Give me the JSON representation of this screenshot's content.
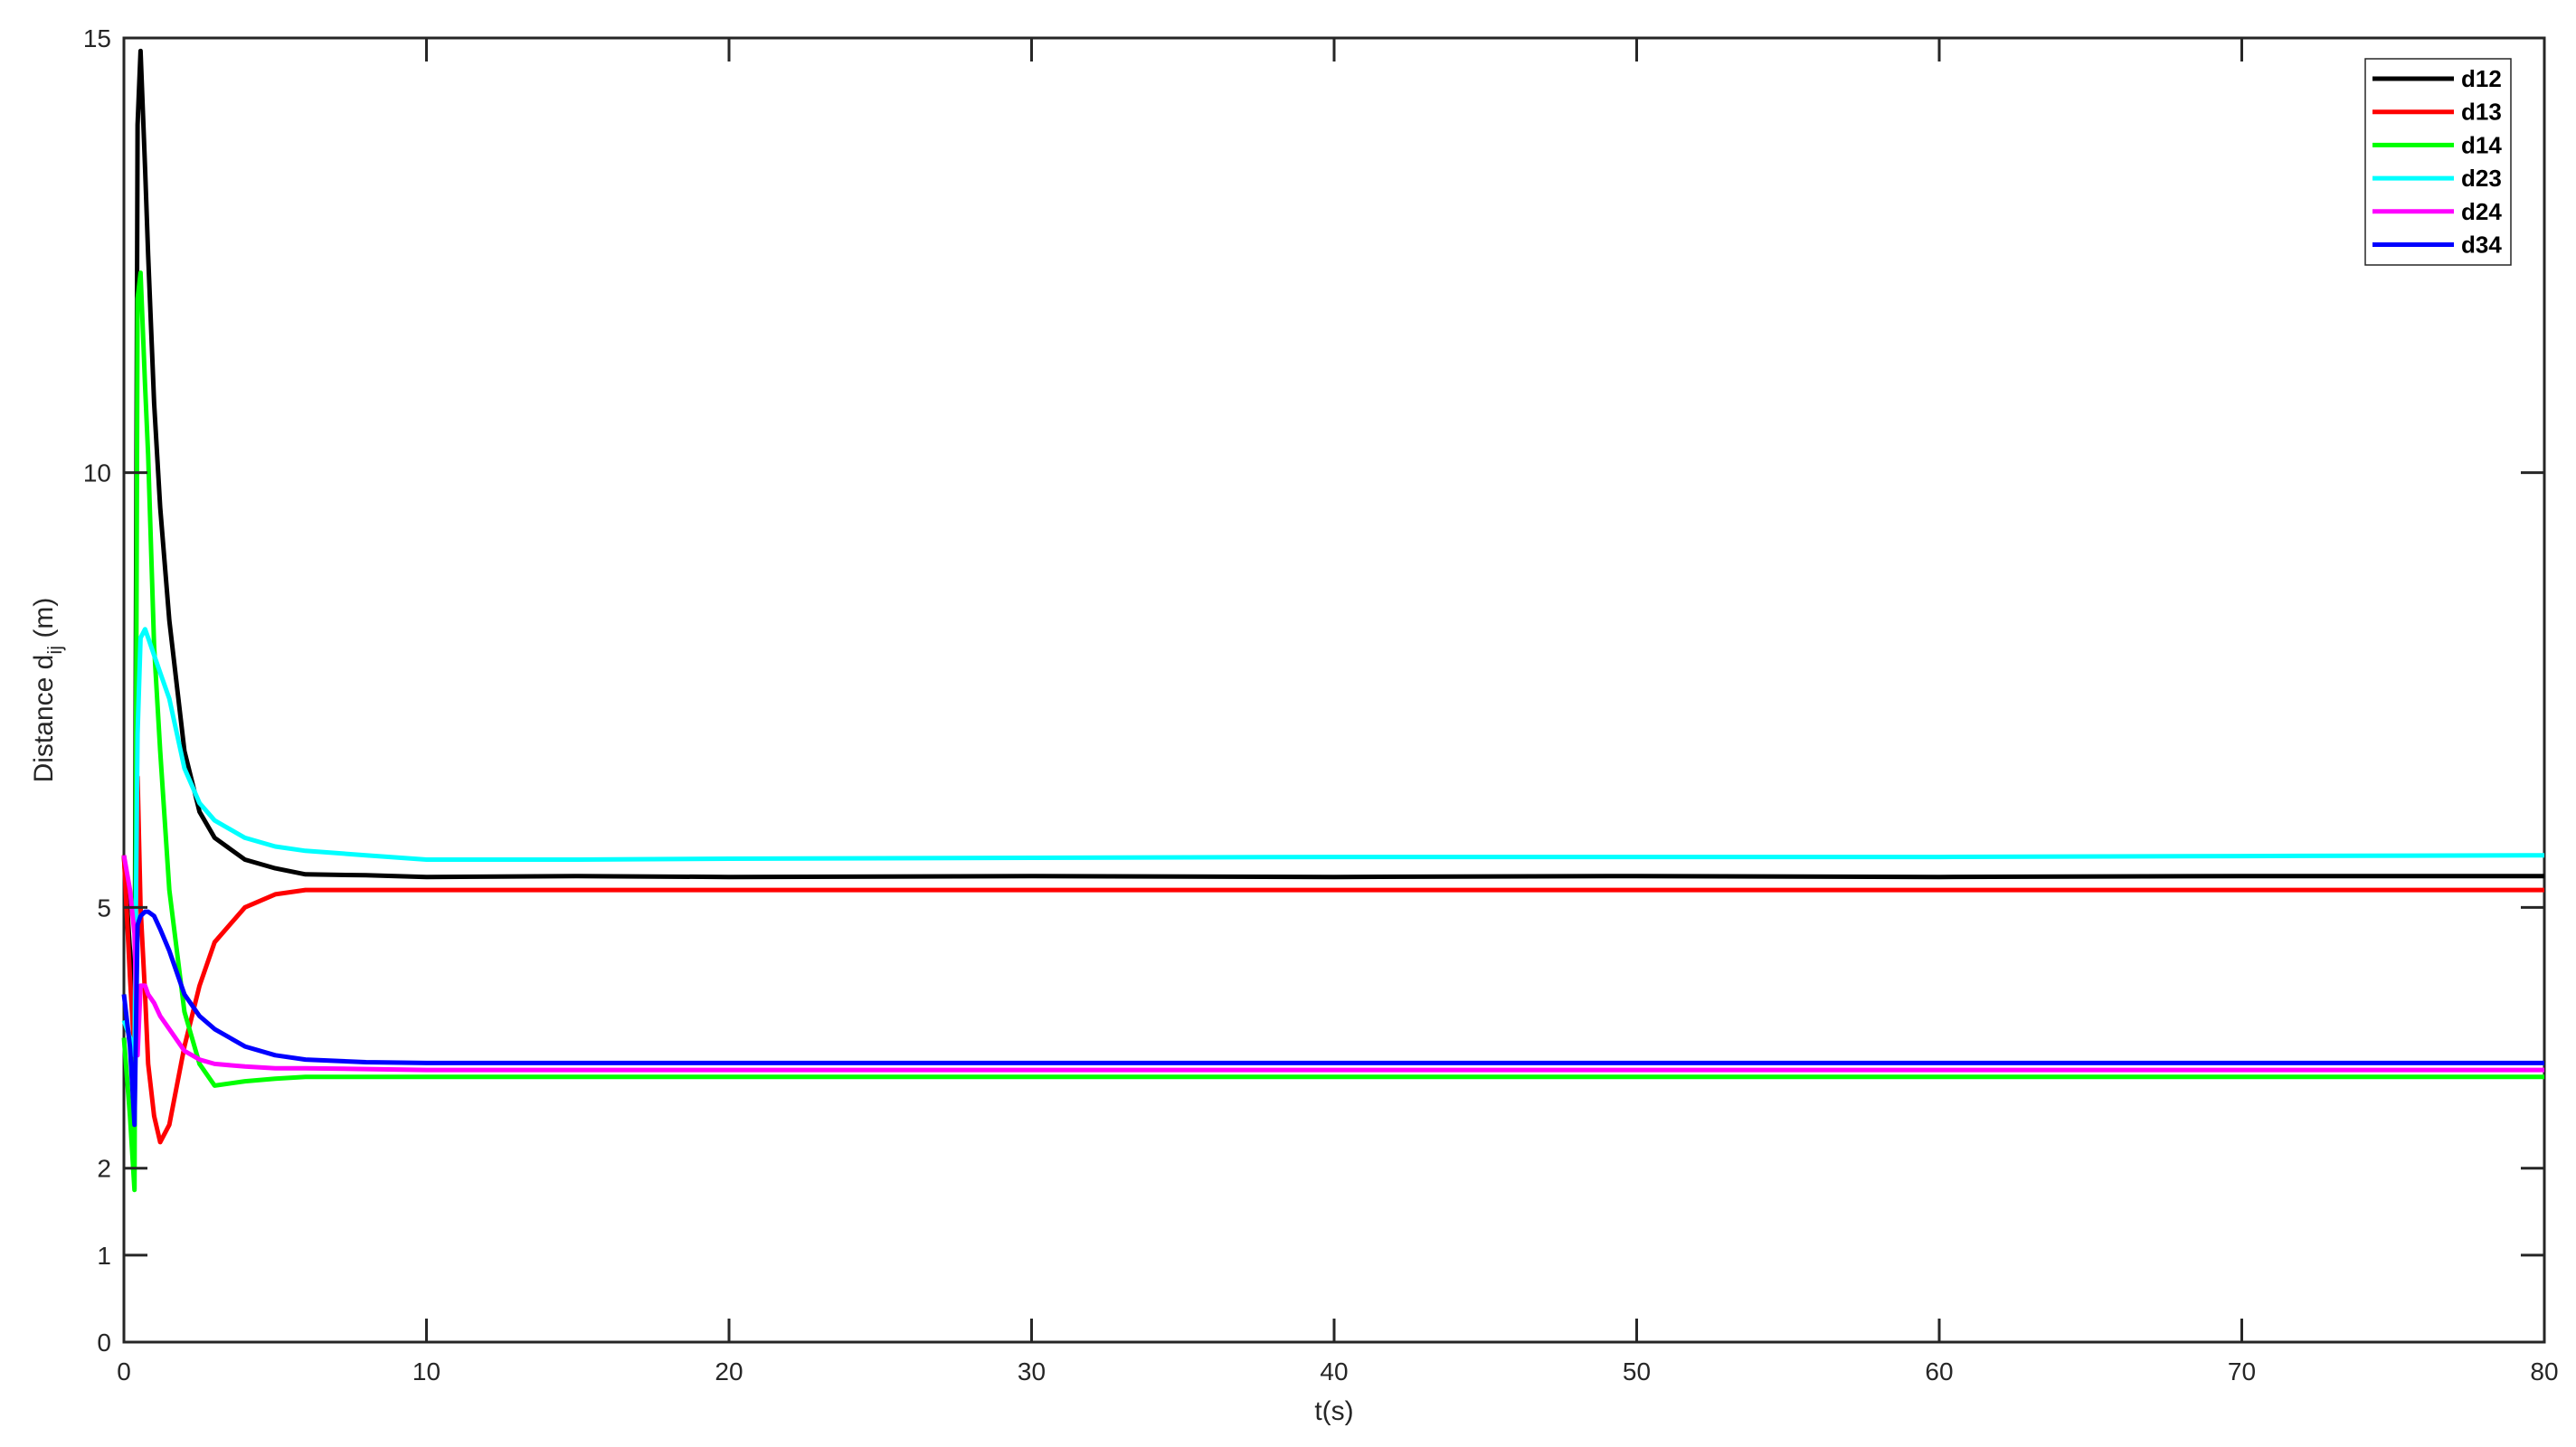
{
  "chart_data": {
    "type": "line",
    "title": "",
    "xlabel": "t(s)",
    "ylabel": "Distance d",
    "ylabel_sub": "ij",
    "ylabel_unit": " (m)",
    "xlim": [
      0,
      80
    ],
    "ylim": [
      0,
      15
    ],
    "xticks": [
      0,
      10,
      20,
      30,
      40,
      50,
      60,
      70,
      80
    ],
    "yticks": [
      0,
      1,
      2,
      5,
      10,
      15
    ],
    "grid": false,
    "legend_position": "top-right",
    "x": [
      0,
      0.2,
      0.35,
      0.45,
      0.55,
      0.7,
      0.8,
      1,
      1.2,
      1.5,
      2,
      2.5,
      3,
      4,
      5,
      6,
      8,
      10,
      15,
      20,
      30,
      40,
      50,
      60,
      70,
      80
    ],
    "series": [
      {
        "name": "d12",
        "color": "#000000",
        "values": [
          5.6,
          4.5,
          3.2,
          14,
          14.85,
          13.5,
          12.5,
          10.8,
          9.6,
          8.3,
          6.8,
          6.1,
          5.8,
          5.55,
          5.45,
          5.38,
          5.37,
          5.35,
          5.36,
          5.35,
          5.36,
          5.35,
          5.36,
          5.35,
          5.36,
          5.36
        ]
      },
      {
        "name": "d13",
        "color": "#ff0000",
        "values": [
          5.6,
          4.2,
          3.3,
          6.5,
          5.0,
          4.0,
          3.2,
          2.6,
          2.3,
          2.5,
          3.4,
          4.1,
          4.6,
          5.0,
          5.15,
          5.2,
          5.2,
          5.2,
          5.2,
          5.2,
          5.2,
          5.2,
          5.2,
          5.2,
          5.2,
          5.2
        ]
      },
      {
        "name": "d14",
        "color": "#00ff00",
        "values": [
          3.5,
          2.6,
          1.75,
          12.0,
          12.3,
          11.0,
          10.2,
          8.0,
          6.8,
          5.2,
          3.8,
          3.2,
          2.95,
          3.0,
          3.03,
          3.05,
          3.05,
          3.05,
          3.05,
          3.05,
          3.05,
          3.05,
          3.05,
          3.05,
          3.05,
          3.05
        ]
      },
      {
        "name": "d23",
        "color": "#00ffff",
        "values": [
          3.7,
          3.5,
          3.3,
          7.0,
          8.1,
          8.2,
          8.1,
          7.9,
          7.7,
          7.4,
          6.6,
          6.2,
          6.0,
          5.8,
          5.7,
          5.65,
          5.6,
          5.55,
          5.55,
          5.56,
          5.57,
          5.58,
          5.58,
          5.58,
          5.59,
          5.6
        ]
      },
      {
        "name": "d24",
        "color": "#ff00ff",
        "values": [
          5.6,
          5.2,
          4.7,
          3.3,
          4.1,
          4.1,
          4.0,
          3.9,
          3.75,
          3.6,
          3.35,
          3.25,
          3.2,
          3.17,
          3.15,
          3.15,
          3.14,
          3.13,
          3.13,
          3.13,
          3.13,
          3.13,
          3.13,
          3.13,
          3.13,
          3.13
        ]
      },
      {
        "name": "d34",
        "color": "#0000ff",
        "values": [
          4.0,
          3.4,
          2.5,
          4.8,
          4.9,
          4.95,
          4.95,
          4.9,
          4.75,
          4.5,
          4.0,
          3.75,
          3.6,
          3.4,
          3.3,
          3.25,
          3.22,
          3.21,
          3.21,
          3.21,
          3.21,
          3.21,
          3.21,
          3.21,
          3.21,
          3.21
        ]
      }
    ]
  }
}
